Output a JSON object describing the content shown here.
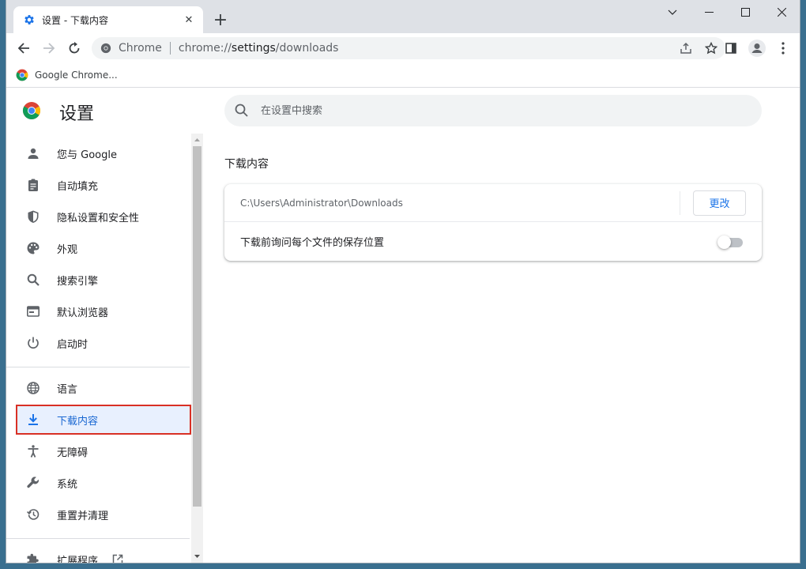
{
  "tab": {
    "title": "设置 - 下载内容",
    "close_glyph": "✕"
  },
  "new_tab_glyph": "+",
  "window_controls": {
    "minimize": "─",
    "maximize": "☐",
    "close": "✕",
    "dropdown": "⌄"
  },
  "omnibox": {
    "site_label": "Chrome",
    "url_scheme": "chrome://",
    "url_host": "settings",
    "url_path": "/downloads"
  },
  "bookmarks": [
    {
      "label": "Google Chrome..."
    }
  ],
  "settings": {
    "title": "设置",
    "search_placeholder": "在设置中搜索",
    "nav": [
      {
        "label": "您与 Google",
        "icon": "person-icon"
      },
      {
        "label": "自动填充",
        "icon": "clipboard-icon"
      },
      {
        "label": "隐私设置和安全性",
        "icon": "shield-icon"
      },
      {
        "label": "外观",
        "icon": "palette-icon"
      },
      {
        "label": "搜索引擎",
        "icon": "search-icon"
      },
      {
        "label": "默认浏览器",
        "icon": "browser-icon"
      },
      {
        "label": "启动时",
        "icon": "power-icon"
      },
      {
        "label": "语言",
        "icon": "globe-icon"
      },
      {
        "label": "下载内容",
        "icon": "download-icon"
      },
      {
        "label": "无障碍",
        "icon": "accessibility-icon"
      },
      {
        "label": "系统",
        "icon": "wrench-icon"
      },
      {
        "label": "重置并清理",
        "icon": "history-icon"
      },
      {
        "label": "扩展程序",
        "icon": "puzzle-icon"
      }
    ],
    "active_nav": "下载内容"
  },
  "downloads": {
    "section_title": "下载内容",
    "location_path": "C:\\Users\\Administrator\\Downloads",
    "change_button": "更改",
    "ask_label": "下载前询问每个文件的保存位置",
    "ask_enabled": false
  },
  "colors": {
    "accent": "#1a73e8",
    "active_bg": "#e8f0fe",
    "highlight_border": "#d93025"
  }
}
